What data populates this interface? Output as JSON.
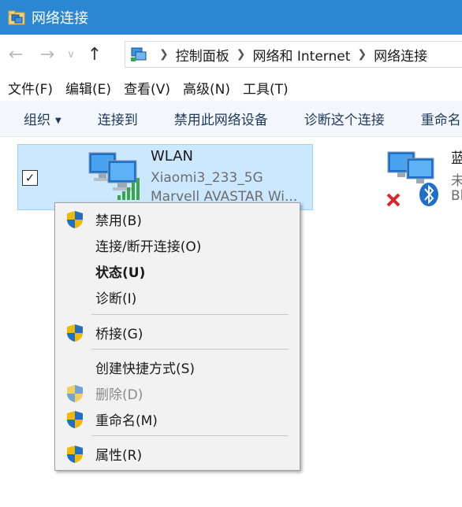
{
  "window": {
    "title": "网络连接"
  },
  "nav": {
    "back_icon": "back-arrow-icon",
    "forward_icon": "forward-arrow-icon",
    "up_icon": "up-arrow-icon"
  },
  "address": {
    "crumbs": [
      "控制面板",
      "网络和 Internet",
      "网络连接"
    ]
  },
  "menubar": {
    "items": [
      "文件(F)",
      "编辑(E)",
      "查看(V)",
      "高级(N)",
      "工具(T)"
    ]
  },
  "cmdbar": {
    "organize": "组织",
    "connect_to": "连接到",
    "disable_device": "禁用此网络设备",
    "diagnose": "诊断这个连接",
    "rename": "重命名"
  },
  "items": {
    "wlan": {
      "name": "WLAN",
      "network": "Xiaomi3_233_5G",
      "adapter": "Marvell AVASTAR Wi..."
    },
    "bluetooth": {
      "name": "蓝",
      "status": "未",
      "adapter": "Bl"
    }
  },
  "context_menu": {
    "disable": "禁用(B)",
    "connect_disconnect": "连接/断开连接(O)",
    "status": "状态(U)",
    "diagnose": "诊断(I)",
    "bridge": "桥接(G)",
    "create_shortcut": "创建快捷方式(S)",
    "delete": "删除(D)",
    "rename": "重命名(M)",
    "properties": "属性(R)"
  },
  "colors": {
    "titlebar": "#2b87d1",
    "selection": "#cce8ff",
    "selection_border": "#99d1ff",
    "cmdbar_bg": "#f3f6fa",
    "menu_bg": "#f2f2f2"
  }
}
